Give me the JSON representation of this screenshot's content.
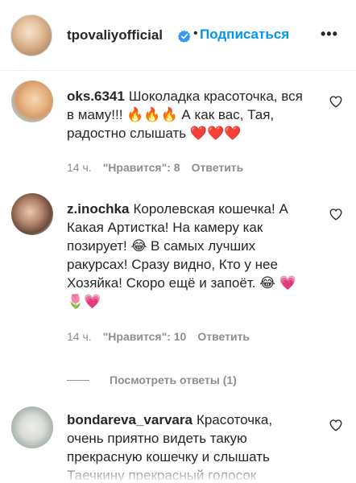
{
  "header": {
    "username": "tpovaliyofficial",
    "separator": "•",
    "follow_label": "Подписаться",
    "more_label": "•••"
  },
  "comments": [
    {
      "username": "oks.6341",
      "text": "Шоколадка красоточка, вся в маму!!! 🔥🔥🔥 А как вас, Тая, радостно слышать ❤️❤️❤️",
      "time": "14 ч.",
      "likes": "\"Нравится\": 8",
      "reply_label": "Ответить"
    },
    {
      "username": "z.inochka",
      "text": "Королевская кошечка! А Какая Артистка! На камеру как позирует! 😂 В самых лучших ракурсах! Сразу видно, Кто у нее Хозяйка! Скоро ещё и запоёт. 😂 💗🌷💗",
      "time": "14 ч.",
      "likes": "\"Нравится\": 10",
      "reply_label": "Ответить"
    },
    {
      "username": "bondareva_varvara",
      "text": "Красоточка, очень приятно видеть такую прекрасную кошечку и слышать Таечкину прекрасный голосок"
    }
  ],
  "view_replies_label": "Посмотреть ответы (1)",
  "colors": {
    "accent": "#0095f6",
    "text": "#262626",
    "secondary": "#8e8e8e"
  },
  "icons": {
    "verified": "verified-badge-icon",
    "like": "heart-outline-icon",
    "more": "more-options-icon"
  }
}
